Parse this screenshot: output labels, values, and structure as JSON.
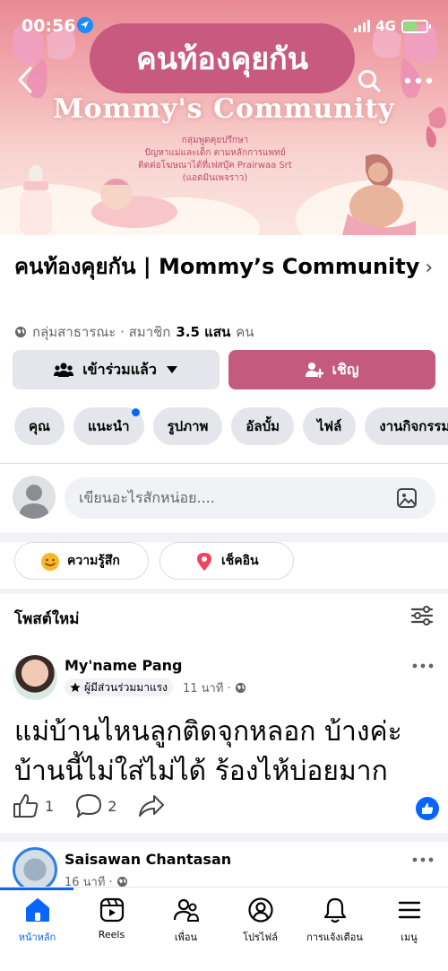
{
  "status_bar": {
    "time": "00:56",
    "network": "4G"
  },
  "cover": {
    "title_thai": "คนท้องคุยกัน",
    "title_en": "Mommy's Community",
    "info_lines": [
      "กลุ่มพูดคุยปรึกษา",
      "ปัญหาแม่และเด็ก ตามหลักการแพทย์",
      "ติดต่อโฆษณาได้ที่เฟสบุ๊ค Prairwaa Srt",
      "(แอดมินเพจราว)"
    ]
  },
  "group": {
    "name": "คนท้องคุยกัน | Mommy’s Community",
    "privacy": "กลุ่มสาธารณะ · สมาชิก",
    "member_count": "3.5 แสน",
    "member_unit": "คน",
    "joined_label": "เข้าร่วมแล้ว",
    "invite_label": "เชิญ"
  },
  "tabs_chips": [
    "คุณ",
    "แนะนำ",
    "รูปภาพ",
    "อัลบั้ม",
    "ไฟล์",
    "งานกิจกรรม"
  ],
  "composer": {
    "placeholder": "เขียนอะไรสักหน่อย...."
  },
  "actions": {
    "feeling": "ความรู้สึก",
    "checkin": "เช็คอิน"
  },
  "feed": {
    "section_title": "โพสต์ใหม่",
    "post1": {
      "author": "My'name Pang",
      "badge": "ผู้มีส่วนร่วมมาแรง",
      "time": "11 นาที ·",
      "body": "แม่บ้านไหนลูกติดจุกหลอก บ้างค่ะ บ้านนี้ไม่ใส่ไม่ได้ ร้องไห้บ่อยมาก",
      "likes": "1",
      "comments": "2"
    },
    "post2": {
      "author": "Saisawan Chantasan",
      "time": "16 นาที ·"
    }
  },
  "tabbar": [
    "หน้าหลัก",
    "Reels",
    "เพื่อน",
    "โปรไฟล์",
    "การแจ้งเตือน",
    "เมนู"
  ],
  "colors": {
    "accent": "#0866ff",
    "brand_pink": "#c45a7e",
    "chip_gray": "#e4e6eb"
  }
}
